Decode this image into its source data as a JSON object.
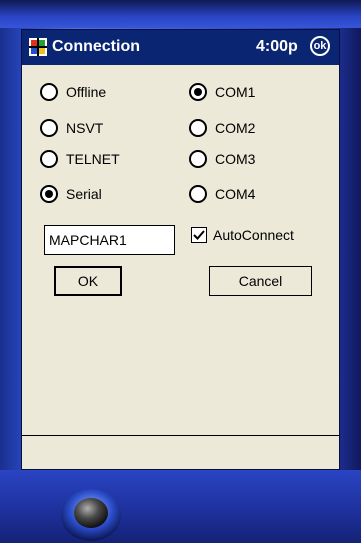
{
  "titlebar": {
    "title": "Connection",
    "clock": "4:00p",
    "ok_label": "ok"
  },
  "connection_types": [
    {
      "label": "Offline",
      "selected": false
    },
    {
      "label": "NSVT",
      "selected": false
    },
    {
      "label": "TELNET",
      "selected": false
    },
    {
      "label": "Serial",
      "selected": true
    }
  ],
  "ports": [
    {
      "label": "COM1",
      "selected": true
    },
    {
      "label": "COM2",
      "selected": false
    },
    {
      "label": "COM3",
      "selected": false
    },
    {
      "label": "COM4",
      "selected": false
    }
  ],
  "host_field": {
    "value": "MAPCHAR1"
  },
  "autoconnect": {
    "label": "AutoConnect",
    "checked": true
  },
  "buttons": {
    "ok": "OK",
    "cancel": "Cancel"
  },
  "colors": {
    "titlebar": "#0a2673",
    "screen_bg": "#ece9d8",
    "device_blue": "#3a5fe0"
  }
}
